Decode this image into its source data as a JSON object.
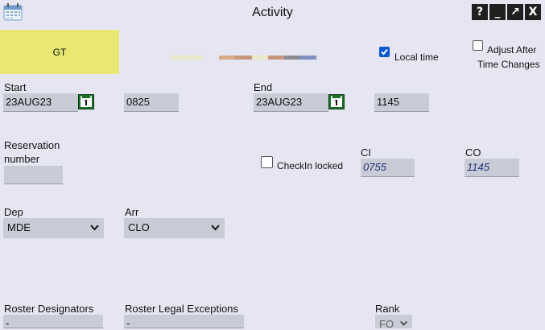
{
  "window": {
    "title": "Activity",
    "buttons": {
      "help": "?",
      "minimize": "_",
      "restore": "↗",
      "close": "X"
    }
  },
  "activity_code": "GT",
  "options": {
    "local_time_label": "Local time",
    "local_time_checked": true,
    "adjust_label_line1": "Adjust After",
    "adjust_label_line2": "Time Changes",
    "adjust_checked": false
  },
  "start": {
    "label": "Start",
    "date": "23AUG23",
    "time": "0825"
  },
  "end": {
    "label": "End",
    "date": "23AUG23",
    "time": "1145"
  },
  "reservation": {
    "label_line1": "Reservation",
    "label_line2": "number",
    "value": ""
  },
  "checkin_locked": {
    "label": "CheckIn locked",
    "checked": false
  },
  "ci": {
    "label": "CI",
    "value": "0755"
  },
  "co": {
    "label": "CO",
    "value": "1145"
  },
  "dep": {
    "label": "Dep",
    "value": "MDE"
  },
  "arr": {
    "label": "Arr",
    "value": "CLO"
  },
  "roster_designators": {
    "label": "Roster Designators",
    "value": "-"
  },
  "roster_legal_exceptions": {
    "label": "Roster Legal Exceptions",
    "value": "-"
  },
  "rank": {
    "label": "Rank",
    "value": "FO"
  },
  "colors": {
    "gt_box": "#e8e872",
    "background": "#e6e6f2",
    "field": "#c9cbd6",
    "checkbox_on": "#0b57d0"
  }
}
